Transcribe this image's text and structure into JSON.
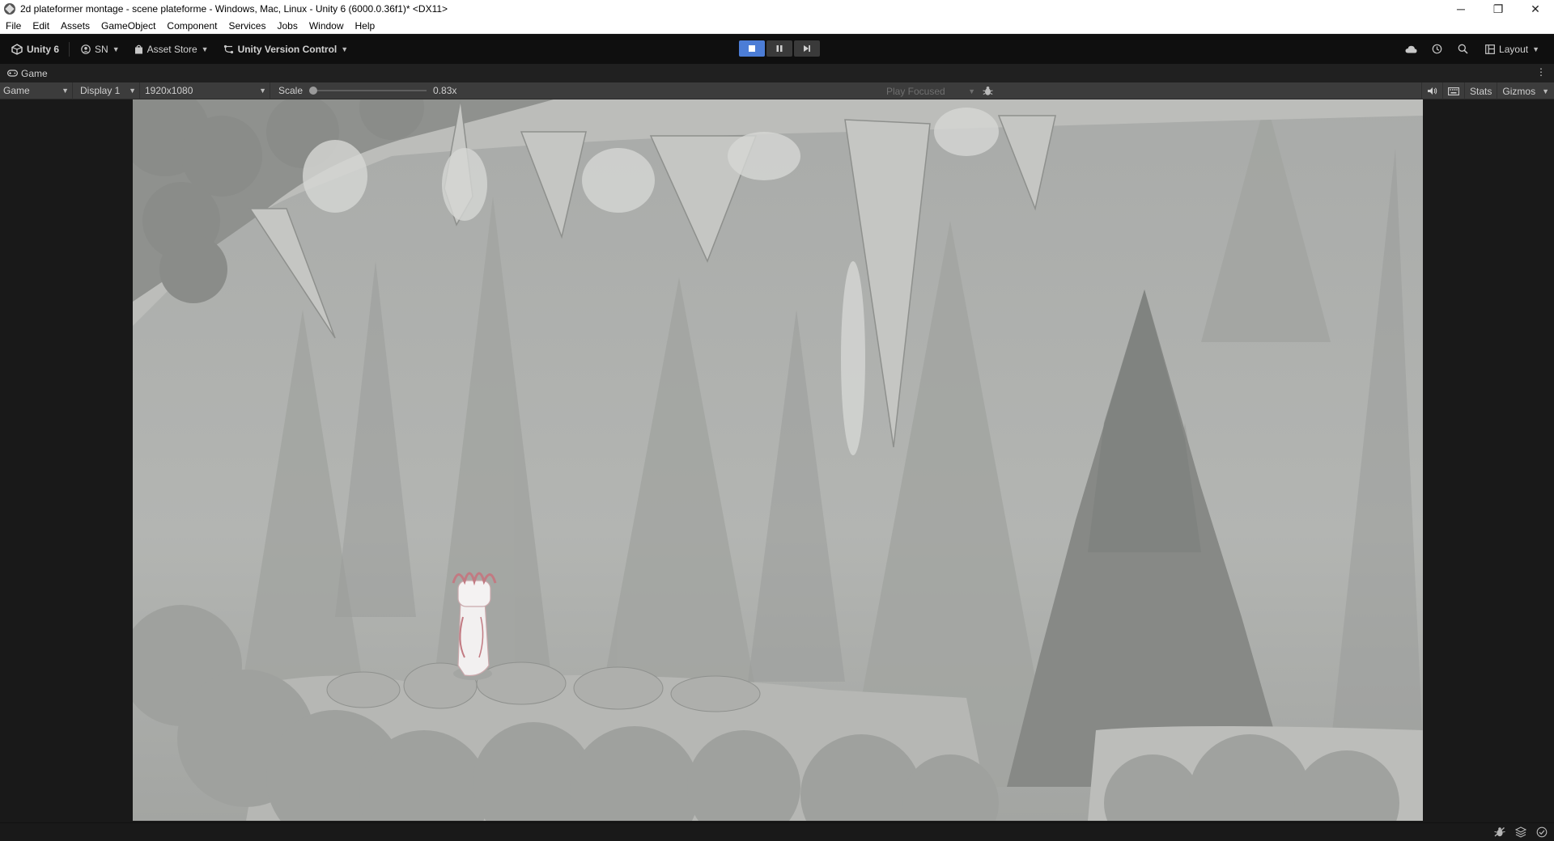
{
  "window": {
    "title": "2d plateformer montage - scene plateforme - Windows, Mac, Linux - Unity 6 (6000.0.36f1)* <DX11>",
    "controls": {
      "minimize": "─",
      "restore": "❐",
      "close": "✕"
    }
  },
  "menu": {
    "items": [
      "File",
      "Edit",
      "Assets",
      "GameObject",
      "Component",
      "Services",
      "Jobs",
      "Window",
      "Help"
    ]
  },
  "toolbar": {
    "unity_label": "Unity 6",
    "account_label": "SN",
    "asset_store_label": "Asset Store",
    "version_control_label": "Unity Version Control",
    "layout_label": "Layout",
    "icons": {
      "cloud": "cloud-icon",
      "history": "history-icon",
      "search": "search-icon",
      "layout": "layout-icon"
    }
  },
  "playmode": {
    "play_active": true,
    "buttons": [
      "play",
      "pause",
      "step"
    ]
  },
  "tab": {
    "label": "Game",
    "icon": "gamepad-icon"
  },
  "gamebar": {
    "view_mode": "Game",
    "display": "Display 1",
    "resolution": "1920x1080",
    "scale_label": "Scale",
    "scale_value": "0.83x",
    "play_focused": "Play Focused",
    "stats_label": "Stats",
    "gizmos_label": "Gizmos"
  },
  "colors": {
    "accent": "#4c7dd6",
    "toolbar_bg": "#0f0f0f",
    "panel_bg": "#3c3c3c",
    "editor_bg": "#191919"
  }
}
